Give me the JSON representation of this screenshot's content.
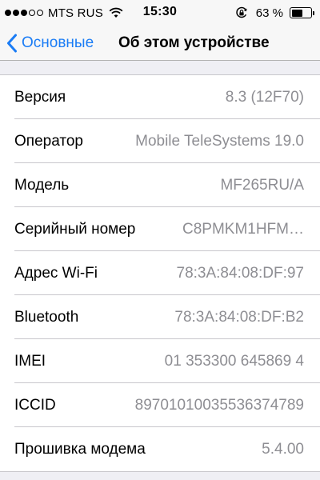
{
  "status_bar": {
    "signal_dots_filled": 3,
    "signal_dots_total": 5,
    "carrier": "MTS RUS",
    "wifi_icon": "wifi-icon",
    "time": "15:30",
    "rotation_lock_icon": "rotation-lock-icon",
    "battery_percent_text": "63 %",
    "battery_level": 0.63
  },
  "nav": {
    "back_label": "Основные",
    "title": "Об этом устройстве"
  },
  "rows": [
    {
      "label": "Версия",
      "value": "8.3 (12F70)"
    },
    {
      "label": "Оператор",
      "value": "Mobile TeleSystems 19.0"
    },
    {
      "label": "Модель",
      "value": "MF265RU/A"
    },
    {
      "label": "Серийный номер",
      "value": "C8PMKM1HFM…"
    },
    {
      "label": "Адрес Wi-Fi",
      "value": "78:3A:84:08:DF:97"
    },
    {
      "label": "Bluetooth",
      "value": "78:3A:84:08:DF:B2"
    },
    {
      "label": "IMEI",
      "value": "01 353300 645869 4"
    },
    {
      "label": "ICCID",
      "value": "89701010035536374789"
    },
    {
      "label": "Прошивка модема",
      "value": "5.4.00"
    }
  ],
  "colors": {
    "accent": "#1a7cf5",
    "value_text": "#8e8e93",
    "background": "#efeff4"
  }
}
